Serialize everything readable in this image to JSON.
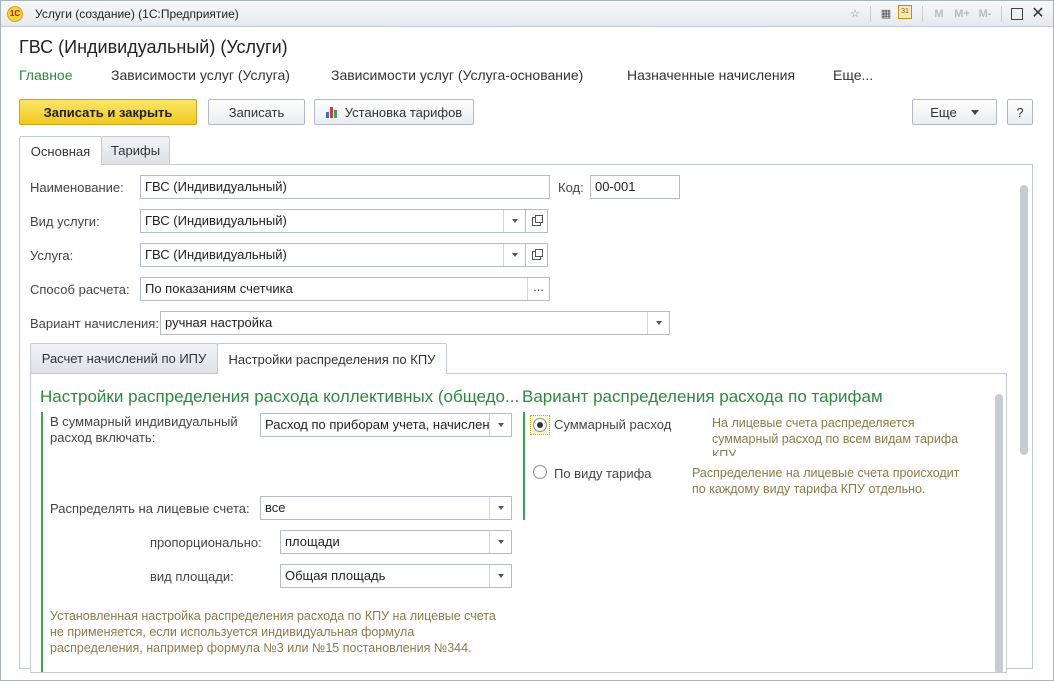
{
  "window": {
    "title": "Услуги (создание) (1С:Предприятие)",
    "logo_text": "1С",
    "controls": [
      "M",
      "M+",
      "M-"
    ]
  },
  "form": {
    "title": "ГВС (Индивидуальный) (Услуги)",
    "nav": [
      "Главное",
      "Зависимости услуг (Услуга)",
      "Зависимости услуг (Услуга-основание)",
      "Назначенные начисления",
      "Еще..."
    ]
  },
  "toolbar": {
    "save_close": "Записать и закрыть",
    "save": "Записать",
    "tariffs": "Установка тарифов",
    "more": "Еще",
    "help": "?"
  },
  "tabs": [
    "Основная",
    "Тарифы"
  ],
  "fields": {
    "name_label": "Наименование:",
    "name_value": "ГВС (Индивидуальный)",
    "code_label": "Код:",
    "code_value": "00-001",
    "service_type_label": "Вид услуги:",
    "service_type_value": "ГВС (Индивидуальный)",
    "service_label": "Услуга:",
    "service_value": "ГВС (Индивидуальный)",
    "calc_method_label": "Способ расчета:",
    "calc_method_value": "По показаниям счетчика",
    "charge_variant_label": "Вариант начисления:",
    "charge_variant_value": "ручная настройка",
    "dots": "..."
  },
  "inner_tabs": [
    "Расчет начислений по ИПУ",
    "Настройки распределения по КПУ"
  ],
  "kpu": {
    "left_title": "Настройки распределения расхода коллективных (общедо...",
    "include_label_1": "В суммарный индивидуальный",
    "include_label_2": "расход включать:",
    "include_value": "Расход по приборам учета, начислен",
    "distribute_label": "Распределять на лицевые счета:",
    "distribute_value": "все",
    "proportional_label": "пропорционально:",
    "proportional_value": "площади",
    "area_type_label": "вид площади:",
    "area_type_value": "Общая площадь",
    "note_1": "Установленная настройка распределения расхода по КПУ на лицевые счета",
    "note_2": "не применяется, если используется индивидуальная формула",
    "note_3": "распределения, например формула №3 или №15 постановления №344.",
    "right_title": "Вариант распределения расхода по тарифам",
    "opt1_label": "Суммарный расход",
    "opt1_hint_1": "На лицевые счета распределяется",
    "opt1_hint_2": "суммарный расход по всем видам тарифа",
    "opt1_hint_3": "КПУ",
    "opt2_label": "По виду тарифа",
    "opt2_hint_1": "Распределение на лицевые счета происходит",
    "opt2_hint_2": "по каждому виду тарифа КПУ отдельно."
  }
}
